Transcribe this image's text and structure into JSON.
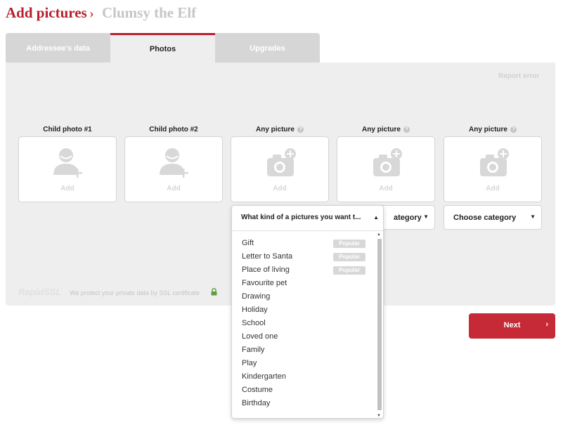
{
  "header": {
    "title": "Add pictures",
    "separator": "›",
    "subtitle": "Clumsy the Elf"
  },
  "tabs": [
    {
      "label": "Addressee's data",
      "active": false
    },
    {
      "label": "Photos",
      "active": true
    },
    {
      "label": "Upgrades",
      "active": false
    }
  ],
  "report_error": "Report error",
  "slots": [
    {
      "label": "Child photo #1",
      "add": "Add",
      "icon": "person-add-icon"
    },
    {
      "label": "Child photo #2",
      "add": "Add",
      "icon": "person-add-icon"
    },
    {
      "label": "Any picture",
      "add": "Add",
      "icon": "camera-add-icon",
      "help": "?"
    },
    {
      "label": "Any picture",
      "add": "Add",
      "icon": "camera-add-icon",
      "help": "?"
    },
    {
      "label": "Any picture",
      "add": "Add",
      "icon": "camera-add-icon",
      "help": "?"
    }
  ],
  "selects": [
    {
      "value": "ategory"
    },
    {
      "value": "Choose category"
    }
  ],
  "dropdown": {
    "question": "What kind of a pictures you want t...",
    "options": [
      {
        "label": "Gift",
        "badge": "Popular"
      },
      {
        "label": "Letter to Santa",
        "badge": "Popular"
      },
      {
        "label": "Place of living",
        "badge": "Popular"
      },
      {
        "label": "Favourite pet"
      },
      {
        "label": "Drawing"
      },
      {
        "label": "Holiday"
      },
      {
        "label": "School"
      },
      {
        "label": "Loved one"
      },
      {
        "label": "Family"
      },
      {
        "label": "Play"
      },
      {
        "label": "Kindergarten"
      },
      {
        "label": "Costume"
      },
      {
        "label": "Birthday"
      }
    ]
  },
  "security": {
    "logo": "RapidSSL",
    "text": "We protect your private data by SSL certificate"
  },
  "next": {
    "label": "Next",
    "arrow": "›"
  },
  "colors": {
    "brand": "#b8202f",
    "button": "#c62a36",
    "panel": "#eeeeee"
  }
}
